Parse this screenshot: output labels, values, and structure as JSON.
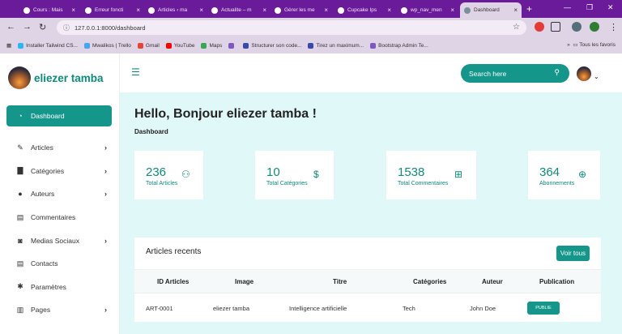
{
  "browser": {
    "tabs": [
      {
        "title": "Cours : Mais",
        "fav": "#b39ddb"
      },
      {
        "title": "Erreur foncti",
        "fav": "#90a4ae"
      },
      {
        "title": "Articles ‹ ma",
        "fav": "#e0e0e0"
      },
      {
        "title": "Actualite – m",
        "fav": "#e0e0e0"
      },
      {
        "title": "Gérer les me",
        "fav": "#8bc34a"
      },
      {
        "title": "Cupcake Ips",
        "fav": "#f48fb1"
      },
      {
        "title": "wp_nav_men",
        "fav": "#e0e0e0"
      },
      {
        "title": "Dashboard",
        "fav": "#78909c"
      }
    ],
    "url": "127.0.0.1:8000/dashboard",
    "bookmarks": [
      {
        "label": "Installer Tailwind CS...",
        "color": "#29b6f6"
      },
      {
        "label": "Mwalikos | Trello",
        "color": "#42a5f5"
      },
      {
        "label": "Gmail",
        "color": "#ea4335"
      },
      {
        "label": "YouTube",
        "color": "#ff0000"
      },
      {
        "label": "Maps",
        "color": "#34a853"
      },
      {
        "label": "",
        "color": "#7e57c2"
      },
      {
        "label": "Structurer son code...",
        "color": "#3949ab"
      },
      {
        "label": "Tirez un maximum...",
        "color": "#3949ab"
      },
      {
        "label": "Bootstrap Admin Te...",
        "color": "#7e57c2"
      }
    ],
    "all_bookmarks": "Tous les favoris"
  },
  "brand": {
    "name": "eliezer tamba"
  },
  "sidebar": {
    "items": [
      {
        "label": "Dashboard",
        "icon": "dashboard-icon",
        "glyph": "◔",
        "chevron": false
      },
      {
        "label": "Articles",
        "icon": "edit-icon",
        "glyph": "✎",
        "chevron": true
      },
      {
        "label": "Catégories",
        "icon": "book-icon",
        "glyph": "▇",
        "chevron": true
      },
      {
        "label": "Auteurs",
        "icon": "user-icon",
        "glyph": "●",
        "chevron": true
      },
      {
        "label": "Commentaires",
        "icon": "table-icon",
        "glyph": "▤",
        "chevron": false
      },
      {
        "label": "Medias Sociaux",
        "icon": "media-icon",
        "glyph": "◙",
        "chevron": true
      },
      {
        "label": "Contacts",
        "icon": "table-icon",
        "glyph": "▤",
        "chevron": false
      },
      {
        "label": "Paramètres",
        "icon": "gear-icon",
        "glyph": "✱",
        "chevron": false
      },
      {
        "label": "Pages",
        "icon": "book-open-icon",
        "glyph": "▥",
        "chevron": true
      }
    ]
  },
  "topbar": {
    "search_placeholder": "Search here"
  },
  "main": {
    "greeting": "Hello, Bonjour eliezer tamba !",
    "breadcrumb": "Dashboard",
    "stats": [
      {
        "value": "236",
        "label": "Total Articles",
        "icon": "user-plus-icon",
        "glyph": "⚇"
      },
      {
        "value": "10",
        "label": "Total Catégories",
        "icon": "dollar-icon",
        "glyph": "$"
      },
      {
        "value": "1538",
        "label": "Total Commentaires",
        "icon": "file-plus-icon",
        "glyph": "⊞"
      },
      {
        "value": "364",
        "label": "Abonnements",
        "icon": "globe-icon",
        "glyph": "⊕"
      }
    ]
  },
  "recent": {
    "title": "Articles recents",
    "button": "Voir tous",
    "columns": [
      "ID Articles",
      "Image",
      "Titre",
      "Catégories",
      "Auteur",
      "Publication"
    ],
    "rows": [
      {
        "id": "ART-0001",
        "image": "eliezer tamba",
        "title": "Intelligence artificielle",
        "category": "Tech",
        "author": "John Doe",
        "status": "PUBLIE"
      }
    ]
  },
  "colors": {
    "accent": "#14968a",
    "accent_text": "#0c8c7a",
    "content_bg": "#e1f8f8",
    "browser": "#6a1b9a"
  }
}
